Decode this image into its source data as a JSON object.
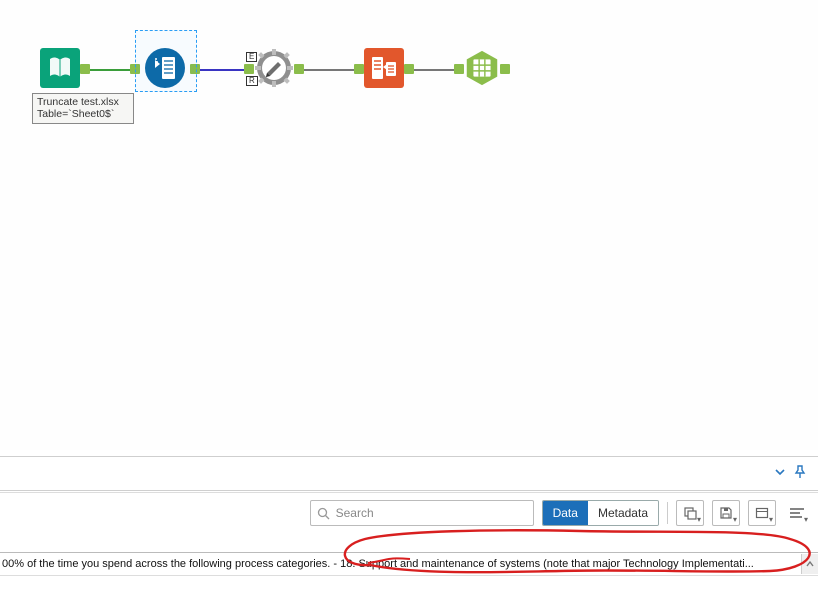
{
  "workflow": {
    "annotation_line1": "Truncate test.xlsx",
    "annotation_line2": "Table=`Sheet0$`",
    "badge_top": "E",
    "badge_bottom": "R",
    "tools": {
      "input": "input-data-tool",
      "select": "select-tool",
      "formula": "formula-tool",
      "output": "output-data-tool",
      "browse": "browse-tool"
    }
  },
  "results": {
    "search_placeholder": "Search",
    "tab_data": "Data",
    "tab_metadata": "Metadata",
    "row_text": "00% of the time you spend across the following process categories. - 18. Support and maintenance of systems (note that major Technology Implementati..."
  }
}
